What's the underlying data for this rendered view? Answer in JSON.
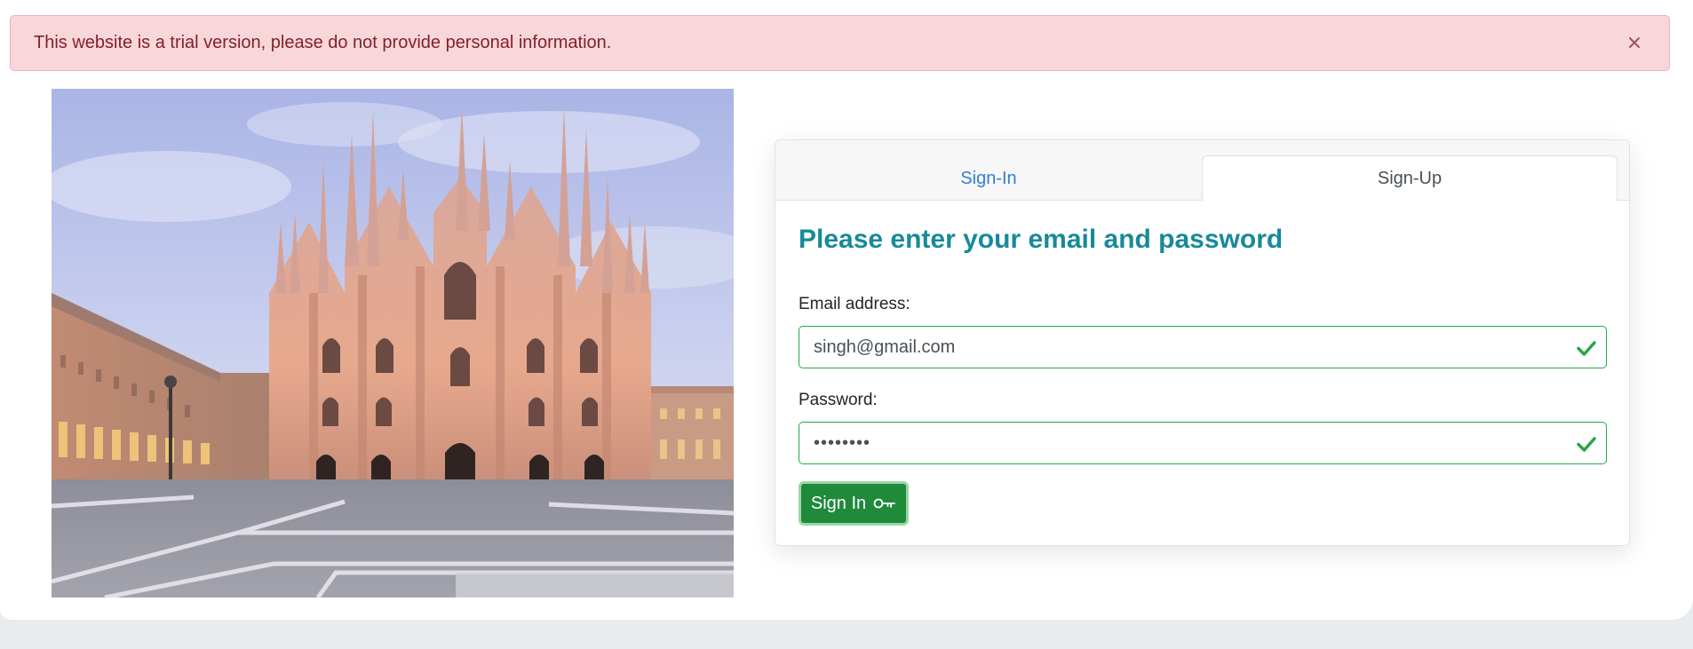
{
  "alert": {
    "message": "This website is a trial version, please do not provide personal information.",
    "close_icon": "close-icon"
  },
  "photo": {
    "subject": "cathedral-photo"
  },
  "tabs": [
    {
      "label": "Sign-In",
      "active": false
    },
    {
      "label": "Sign-Up",
      "active": true
    }
  ],
  "form": {
    "heading": "Please enter your email and password",
    "email_label": "Email address:",
    "email_value": "singh@gmail.com",
    "password_label": "Password:",
    "password_value": "••••••••",
    "valid_icon": "check-icon",
    "submit_label": "Sign In",
    "submit_icon": "key-icon"
  },
  "colors": {
    "alert_bg": "#f8d7da",
    "heading": "#178a9a",
    "valid": "#28a745",
    "button": "#1e8a3a",
    "tab_link": "#2f7fd6"
  }
}
